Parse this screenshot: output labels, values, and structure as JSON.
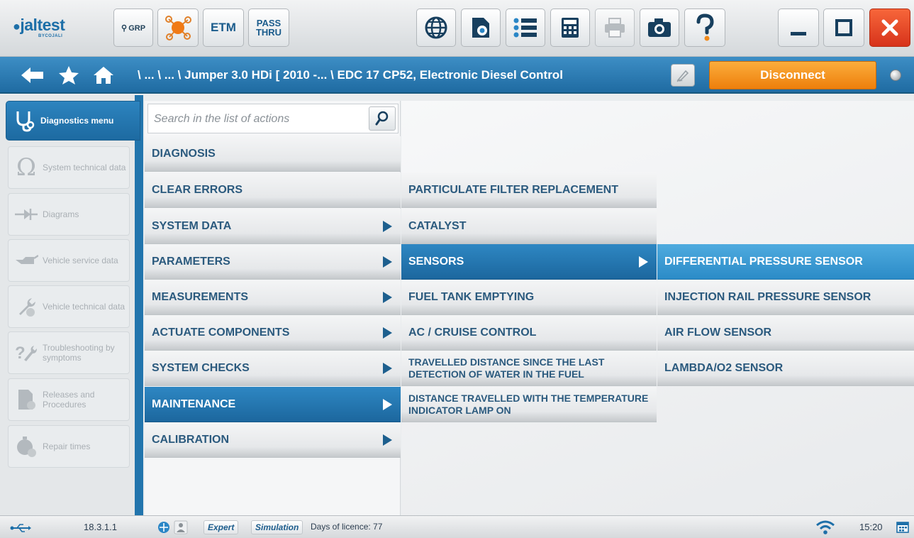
{
  "toolbar": {
    "logo_text": "jaltest",
    "logo_sub": "BYCOJALI",
    "grp_label": "GRP",
    "etm_label": "ETM",
    "pass_label": "PASS",
    "thru_label": "THRU"
  },
  "navbar": {
    "breadcrumb": "\\ ... \\ ... \\ Jumper 3.0 HDi [ 2010 -... \\ EDC 17 CP52, Electronic Diesel Control",
    "disconnect_label": "Disconnect"
  },
  "sidemenu": {
    "items": [
      {
        "label": "Diagnostics menu",
        "icon": "stethoscope-icon",
        "active": true
      },
      {
        "label": "System technical data",
        "icon": "omega-icon"
      },
      {
        "label": "Diagrams",
        "icon": "diagram-icon"
      },
      {
        "label": "Vehicle service data",
        "icon": "oil-can-icon"
      },
      {
        "label": "Vehicle technical data",
        "icon": "wrench-icon"
      },
      {
        "label": "Troubleshooting by symptoms",
        "icon": "question-wrench-icon"
      },
      {
        "label": "Releases and Procedures",
        "icon": "document-icon"
      },
      {
        "label": "Repair times",
        "icon": "stopwatch-icon"
      }
    ]
  },
  "search": {
    "placeholder": "Search in the list of actions"
  },
  "menu1": {
    "items": [
      {
        "label": "DIAGNOSIS"
      },
      {
        "label": "CLEAR ERRORS"
      },
      {
        "label": "SYSTEM DATA"
      },
      {
        "label": "PARAMETERS"
      },
      {
        "label": "MEASUREMENTS"
      },
      {
        "label": "ACTUATE COMPONENTS"
      },
      {
        "label": "SYSTEM CHECKS"
      },
      {
        "label": "MAINTENANCE"
      },
      {
        "label": "CALIBRATION"
      }
    ]
  },
  "menu2": {
    "items": [
      {
        "label": "PARTICULATE FILTER REPLACEMENT"
      },
      {
        "label": "CATALYST"
      },
      {
        "label": "SENSORS"
      },
      {
        "label": "FUEL TANK EMPTYING"
      },
      {
        "label": "AC / CRUISE CONTROL"
      },
      {
        "label": "TRAVELLED DISTANCE SINCE THE LAST DETECTION OF WATER IN THE FUEL"
      },
      {
        "label": "DISTANCE TRAVELLED WITH THE TEMPERATURE INDICATOR LAMP ON"
      }
    ]
  },
  "menu3": {
    "items": [
      {
        "label": "DIFFERENTIAL PRESSURE SENSOR"
      },
      {
        "label": "INJECTION RAIL PRESSURE SENSOR"
      },
      {
        "label": "AIR FLOW SENSOR"
      },
      {
        "label": "LAMBDA/O2 SENSOR"
      }
    ]
  },
  "statusbar": {
    "version": "18.3.1.1",
    "mode_expert": "Expert",
    "mode_simulation": "Simulation",
    "licence": "Days of licence: 77",
    "time": "15:20"
  },
  "colors": {
    "accent_blue": "#2275ad",
    "disconnect_orange": "#ee7f0b",
    "close_red": "#d7331b",
    "highlight_blue": "#2b8bc7"
  }
}
